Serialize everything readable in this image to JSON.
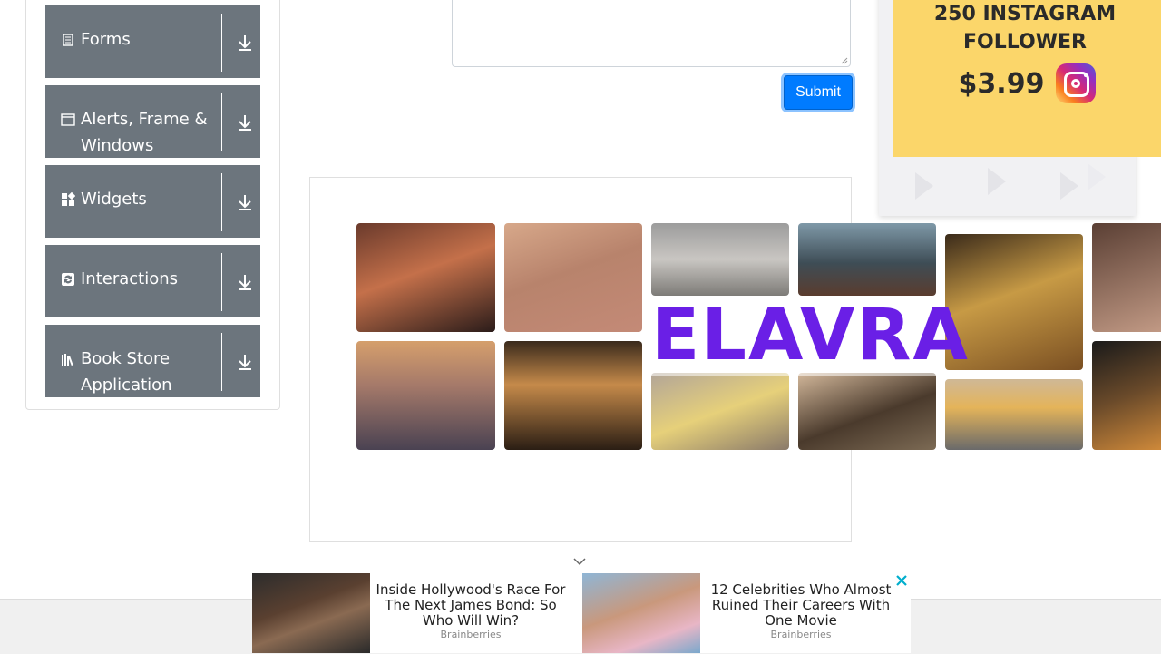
{
  "sidebar": {
    "groups": [
      {
        "label": "Forms",
        "icon": "form-icon"
      },
      {
        "label": "Alerts, Frame & Windows",
        "icon": "window-icon"
      },
      {
        "label": "Widgets",
        "icon": "widgets-icon"
      },
      {
        "label": "Interactions",
        "icon": "interactions-icon"
      },
      {
        "label": "Book Store Application",
        "icon": "books-icon"
      }
    ]
  },
  "form": {
    "submit_label": "Submit"
  },
  "ad_right": {
    "line1": "250 INSTAGRAM",
    "line2": "FOLLOWER",
    "price": "$3.99"
  },
  "ad_middle": {
    "brand": "ELAVRA"
  },
  "bottom_ads": [
    {
      "title": "Inside Hollywood's Race For The Next James Bond: So Who Will Win?",
      "source": "Brainberries"
    },
    {
      "title": "12 Celebrities Who Almost Ruined Their Careers With One Movie",
      "source": "Brainberries"
    }
  ],
  "colors": {
    "sidebar_group_bg": "#6c757d",
    "submit_bg": "#007bff",
    "ad_yellow": "#fbd66a",
    "brand_purple": "#6a1fe6"
  }
}
